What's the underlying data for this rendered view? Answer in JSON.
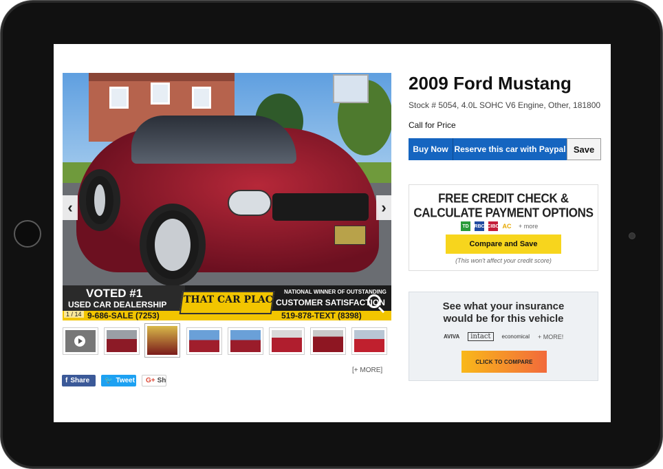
{
  "listing": {
    "title": "2009 Ford Mustang",
    "subtitle": "Stock # 5054, 4.0L SOHC V6 Engine, Other, 181800",
    "price": "Call for Price",
    "buttons": {
      "buy_now": "Buy Now",
      "reserve": "Reserve this car with Paypal",
      "save": "Save"
    }
  },
  "gallery": {
    "counter": "1 / 14",
    "more_label": "[+ MORE]",
    "prev_glyph": "‹",
    "next_glyph": "›",
    "banner": {
      "voted": "VOTED #1",
      "used": "USED CAR DEALERSHIP",
      "logo": "THAT CAR PLACE.CA",
      "national": "NATIONAL WINNER OF OUTSTANDING",
      "satisfaction": "CUSTOMER SATISFACTION",
      "phone_left": "9-686-SALE (7253)",
      "phone_right": "519-878-TEXT (8398)"
    }
  },
  "social": {
    "facebook": "Share",
    "twitter": "Tweet",
    "google_g": "G+",
    "google": "Shar"
  },
  "credit": {
    "heading_line1": "FREE CREDIT CHECK &",
    "heading_line2": "CALCULATE PAYMENT OPTIONS",
    "banks": [
      "TD",
      "RBC",
      "CIBC",
      "AC"
    ],
    "more": "+ more",
    "button": "Compare and Save",
    "note": "(This won't affect your credit score)"
  },
  "insurance": {
    "heading_line1": "See what your insurance",
    "heading_line2": "would be for this vehicle",
    "logos": [
      "AVIVA",
      "intact",
      "economical"
    ],
    "more": "+ MORE!",
    "button": "CLICK TO COMPARE"
  },
  "colors": {
    "primary_button": "#1565c0",
    "yellow_cta": "#f7d51d",
    "insurance_gradient_start": "#f9b81a",
    "insurance_gradient_end": "#f26a3b"
  }
}
